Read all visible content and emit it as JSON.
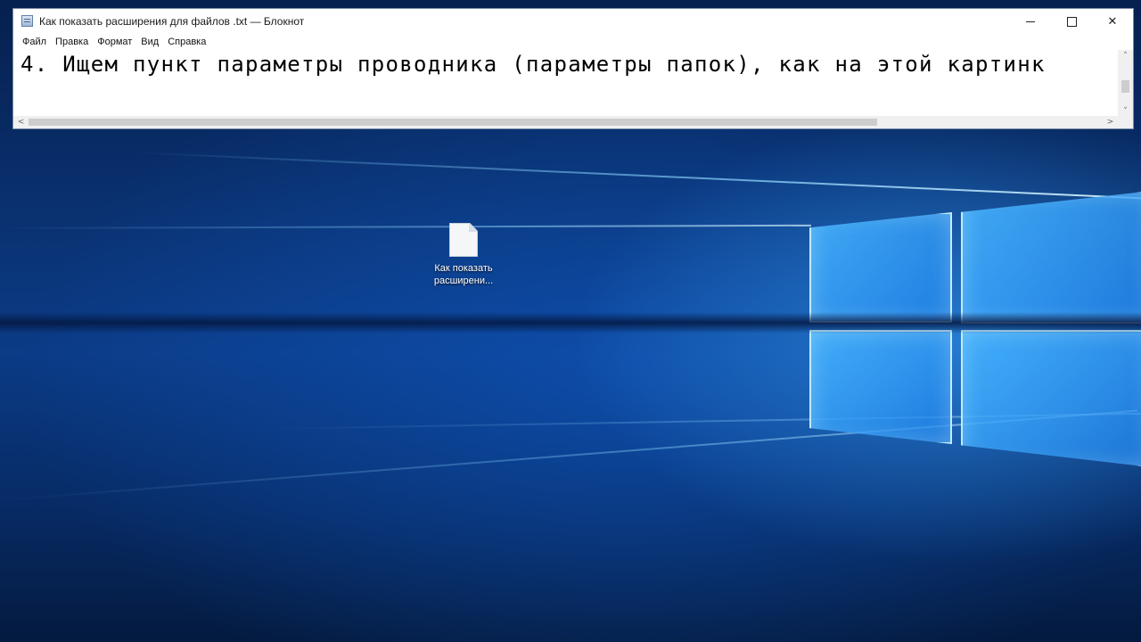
{
  "window": {
    "title": "Как показать расширения для файлов .txt — Блокнот",
    "icon": "notepad-icon",
    "controls": {
      "minimize": "minimize-icon",
      "maximize": "maximize-icon",
      "close_glyph": "✕"
    }
  },
  "menu": [
    {
      "label": "Файл"
    },
    {
      "label": "Правка"
    },
    {
      "label": "Формат"
    },
    {
      "label": "Вид"
    },
    {
      "label": "Справка"
    }
  ],
  "editor": {
    "text": "4. Ищем пункт параметры проводника (параметры папок), как на этой картинк"
  },
  "scrollbars": {
    "up_glyph": "˄",
    "down_glyph": "˅",
    "left_glyph": "<",
    "right_glyph": ">",
    "horizontal_thumb_fraction": 0.79
  },
  "desktop": {
    "icon": {
      "icon_name": "text-file-icon",
      "label_line1": "Как показать",
      "label_line2": "расширени..."
    }
  },
  "colors": {
    "desktop_dark": "#06204f",
    "desktop_accent": "#3aa8ff",
    "window_bg": "#ffffff"
  }
}
